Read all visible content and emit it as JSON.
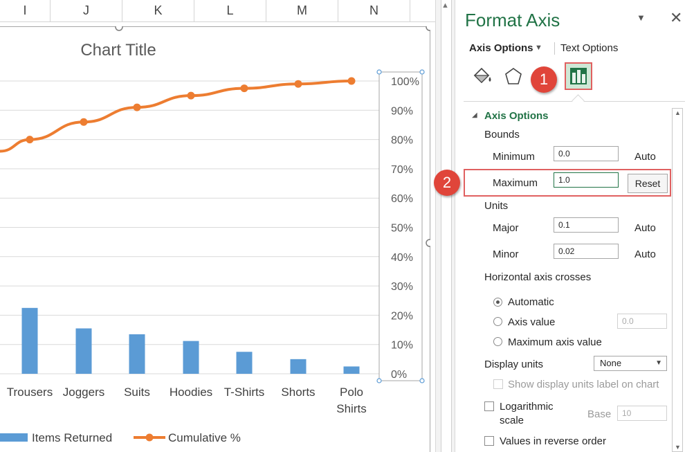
{
  "sheet": {
    "columns": [
      "I",
      "J",
      "K",
      "L",
      "M",
      "N"
    ]
  },
  "chart_data": {
    "type": "bar",
    "title": "Chart Title",
    "categories": [
      "Trousers",
      "Joggers",
      "Suits",
      "Hoodies",
      "T-Shirts",
      "Shorts",
      "Polo Shirts"
    ],
    "series": [
      {
        "name": "Items Returned",
        "type": "bar",
        "color": "#5b9bd5",
        "values": [
          225,
          155,
          135,
          112,
          75,
          50,
          25
        ]
      },
      {
        "name": "Cumulative %",
        "type": "line",
        "color": "#ed7d31",
        "partial_start": 0.76,
        "values": [
          0.8,
          0.86,
          0.91,
          0.95,
          0.975,
          0.99,
          1.0
        ]
      }
    ],
    "secondary_axis": {
      "ticks": [
        "100%",
        "90%",
        "80%",
        "70%",
        "60%",
        "50%",
        "40%",
        "30%",
        "20%",
        "10%",
        "0%"
      ],
      "ylim": [
        0,
        1
      ]
    },
    "primary_ylim": [
      0,
      1000
    ],
    "grid": true,
    "legend": "bottom"
  },
  "pane": {
    "title": "Format Axis",
    "tab_axis": "Axis Options",
    "tab_text": "Text Options",
    "section": "Axis Options",
    "bounds": "Bounds",
    "minimum": {
      "label": "Minimum",
      "value": "0.0",
      "state": "Auto"
    },
    "maximum": {
      "label": "Maximum",
      "value": "1.0",
      "state": "Reset"
    },
    "units": "Units",
    "major": {
      "label": "Major",
      "value": "0.1",
      "state": "Auto"
    },
    "minor": {
      "label": "Minor",
      "value": "0.02",
      "state": "Auto"
    },
    "hcross": "Horizontal axis crosses",
    "radio_automatic": "Automatic",
    "radio_axis_value": "Axis value",
    "axis_value": "0.0",
    "radio_max": "Maximum axis value",
    "display_units": "Display units",
    "display_units_value": "None",
    "show_du_label": "Show display units label on chart",
    "log_1": "Logarithmic",
    "log_2": "scale",
    "base_label": "Base",
    "base_value": "10",
    "reverse": "Values in reverse order"
  },
  "callouts": {
    "one": "1",
    "two": "2"
  }
}
